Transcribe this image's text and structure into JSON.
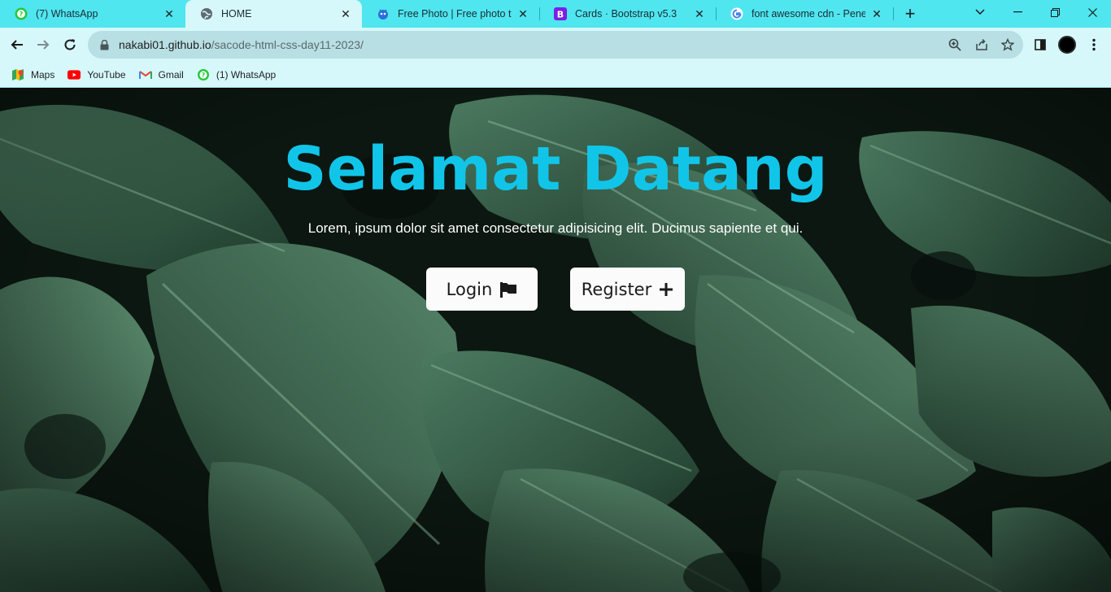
{
  "browser": {
    "tabs": [
      {
        "title": "(7) WhatsApp",
        "icon": "whatsapp-icon",
        "active": false
      },
      {
        "title": "HOME",
        "icon": "globe-icon",
        "active": true
      },
      {
        "title": "Free Photo | Free photo tropi",
        "icon": "freepik-icon",
        "active": false
      },
      {
        "title": "Cards · Bootstrap v5.3",
        "icon": "bootstrap-icon",
        "active": false
      },
      {
        "title": "font awesome cdn - Penelusu",
        "icon": "google-icon",
        "active": false
      }
    ],
    "new_tab": "+",
    "url_host": "nakabi01.github.io",
    "url_path": "/sacode-html-css-day11-2023/",
    "bookmarks": [
      {
        "label": "Maps",
        "icon": "maps-icon"
      },
      {
        "label": "YouTube",
        "icon": "youtube-icon"
      },
      {
        "label": "Gmail",
        "icon": "gmail-icon"
      },
      {
        "label": "(1) WhatsApp",
        "icon": "whatsapp-icon"
      }
    ],
    "colors": {
      "tab_strip": "#4fe6f0",
      "toolbar": "#d6f8fb"
    }
  },
  "page": {
    "title": "Selamat Datang",
    "subtitle": "Lorem, ipsum dolor sit amet consectetur adipisicing elit. Ducimus sapiente et qui.",
    "buttons": {
      "login": {
        "label": "Login",
        "icon": "flag-icon"
      },
      "register": {
        "label": "Register",
        "icon": "plus-icon"
      }
    },
    "background": "tropical monstera leaves photo",
    "colors": {
      "title": "#11c5e9",
      "button_bg": "#fbfbfc"
    }
  }
}
